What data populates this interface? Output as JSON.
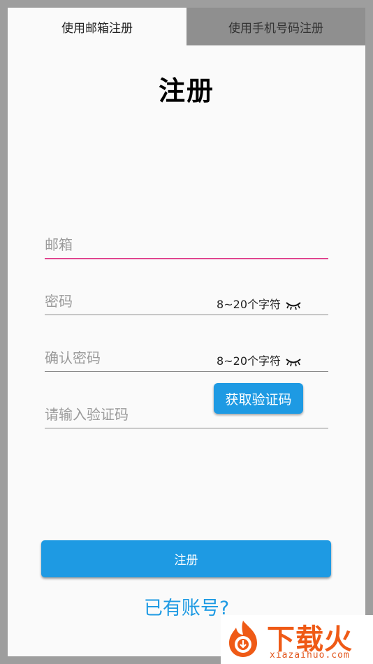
{
  "tabs": [
    {
      "label": "使用邮箱注册",
      "active": true
    },
    {
      "label": "使用手机号码注册",
      "active": false
    }
  ],
  "page_title": "注册",
  "form": {
    "email": {
      "placeholder": "邮箱"
    },
    "password": {
      "placeholder": "密码",
      "hint": "8~20个字符"
    },
    "confirm_password": {
      "placeholder": "确认密码",
      "hint": "8~20个字符"
    },
    "code": {
      "placeholder": "请输入验证码"
    },
    "get_code_label": "获取验证码",
    "submit_label": "注册"
  },
  "login_link": "已有账号?",
  "watermark": {
    "brand": "下载火",
    "domain": "xiazaihuo.com"
  },
  "colors": {
    "accent": "#1e9ae3",
    "focus_underline": "#e0458f",
    "watermark": "#ef5a16"
  },
  "icons": {
    "eye": "eye-closed-icon"
  }
}
